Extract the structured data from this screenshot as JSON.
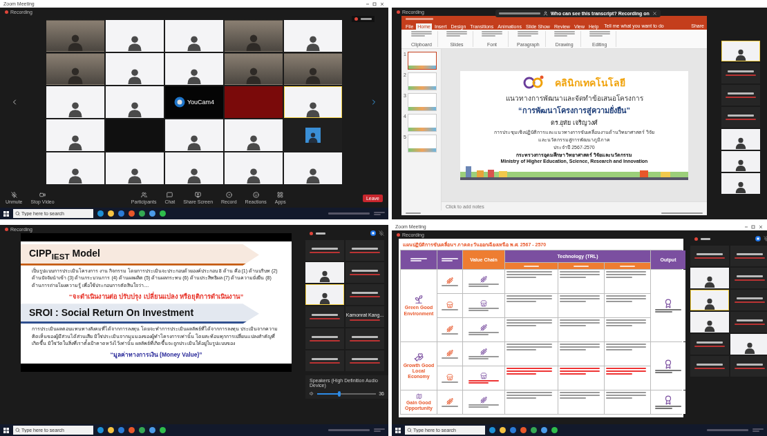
{
  "panels": [
    {
      "kind": "gallery",
      "window_title": "Zoom Meeting",
      "recording": "Recording",
      "tiles": [
        {
          "kind": "camera",
          "speaking": false
        },
        {
          "kind": "slide",
          "speaking": false
        },
        {
          "kind": "slide",
          "speaking": false
        },
        {
          "kind": "camera",
          "speaking": false
        },
        {
          "kind": "slide",
          "speaking": false
        },
        {
          "kind": "camera",
          "speaking": false
        },
        {
          "kind": "slide",
          "speaking": false
        },
        {
          "kind": "slide",
          "speaking": false
        },
        {
          "kind": "camera",
          "speaking": false
        },
        {
          "kind": "camera",
          "speaking": false
        },
        {
          "kind": "slide",
          "speaking": false
        },
        {
          "kind": "slide",
          "speaking": false
        },
        {
          "kind": "logo",
          "label": "YouCam4",
          "speaking": false
        },
        {
          "kind": "blank-red",
          "speaking": false
        },
        {
          "kind": "slide",
          "speaking": true
        },
        {
          "kind": "slide",
          "speaking": false
        },
        {
          "kind": "blank-dark",
          "speaking": false
        },
        {
          "kind": "slide",
          "speaking": false
        },
        {
          "kind": "slide",
          "speaking": false
        },
        {
          "kind": "avatar",
          "speaking": false
        },
        {
          "kind": "slide",
          "speaking": false
        },
        {
          "kind": "slide",
          "speaking": false
        },
        {
          "kind": "slide",
          "speaking": false
        },
        {
          "kind": "slide",
          "speaking": false
        },
        {
          "kind": "slide",
          "speaking": false
        }
      ],
      "toolbar_left": [
        {
          "kind": "mic",
          "label": "Unmute"
        },
        {
          "kind": "video",
          "label": "Stop Video"
        }
      ],
      "toolbar_center": [
        {
          "kind": "people",
          "label": "Participants"
        },
        {
          "kind": "chat",
          "label": "Chat"
        },
        {
          "kind": "share",
          "label": "Share Screen"
        },
        {
          "kind": "record",
          "label": "Record"
        },
        {
          "kind": "react",
          "label": "Reactions"
        },
        {
          "kind": "apps",
          "label": "Apps"
        }
      ],
      "leave": "Leave",
      "taskbar": {
        "search_placeholder": "Type here to search"
      }
    },
    {
      "kind": "presentation",
      "recording": "Recording",
      "notice": "Who can see this transcript? Recording on",
      "ribbon_tabs": [
        {
          "label": "File",
          "selected": false
        },
        {
          "label": "Home",
          "selected": true
        },
        {
          "label": "Insert",
          "selected": false
        },
        {
          "label": "Design",
          "selected": false
        },
        {
          "label": "Transitions",
          "selected": false
        },
        {
          "label": "Animations",
          "selected": false
        },
        {
          "label": "Slide Show",
          "selected": false
        },
        {
          "label": "Review",
          "selected": false
        },
        {
          "label": "View",
          "selected": false
        },
        {
          "label": "Help",
          "selected": false
        }
      ],
      "tell_me": "Tell me what you want to do",
      "share": "Share",
      "ribbon_groups": [
        "Clipboard",
        "Slides",
        "Font",
        "Paragraph",
        "Drawing",
        "Editing"
      ],
      "thumbnails": [
        {
          "number": "1",
          "selected": true
        },
        {
          "number": "2",
          "selected": false
        },
        {
          "number": "3",
          "selected": false
        },
        {
          "number": "4",
          "selected": false
        },
        {
          "number": "5",
          "selected": false
        }
      ],
      "slide": {
        "brand": "คลินิกเทคโนโลยี",
        "lines": [
          {
            "kind": "heading",
            "text": "แนวทางการพัฒนาและจัดทำข้อเสนอโครงการ"
          },
          {
            "kind": "title",
            "text": "“การพัฒนาโครงการสู่ความยั่งยืน”"
          },
          {
            "kind": "name",
            "text": "ดร.อุทัย เจริญวงศ์"
          },
          {
            "kind": "small",
            "text": "การประชุมเชิงปฏิบัติการและแนวทางการขับเคลื่อนงานด้านวิทยาศาสตร์ วิจัย"
          },
          {
            "kind": "small",
            "text": "และนวัตกรรมสู่การพัฒนาภูมิภาค"
          },
          {
            "kind": "small",
            "text": "ประจำปี 2567-2570"
          },
          {
            "kind": "ministry",
            "text": "กระทรวงการอุดมศึกษา วิทยาศาสตร์ วิจัยและนวัตกรรม"
          },
          {
            "kind": "ministry",
            "text": "Ministry of Higher Education, Science, Research and Innovation"
          }
        ]
      },
      "notes_placeholder": "Click to add notes",
      "participants": [
        {
          "kind": "video",
          "speaking": true
        },
        {
          "kind": "name",
          "speaking": false
        },
        {
          "kind": "name",
          "speaking": false
        },
        {
          "kind": "name",
          "speaking": false
        },
        {
          "kind": "video",
          "speaking": false
        },
        {
          "kind": "video",
          "speaking": false
        },
        {
          "kind": "video",
          "speaking": false
        }
      ]
    },
    {
      "kind": "slide-share",
      "recording": "Recording",
      "sections": [
        {
          "heading": "CIPP$_{IEST}$ Model",
          "color": "#c55a11",
          "body": "เป็นรูปแบบการประเมินโครงการ งาน กิจกรรม โดยการประเมินจะประกอบด้วยองค์ประกอบ 8 ด้าน คือ (1) ด้านบริบท (2) ด้านปัจจัยนำเข้า (3) ด้านกระบวนการ (4) ด้านผลผลิต (5) ด้านผลกระทบ (6) ด้านประสิทธิผล (7) ด้านความยั่งยืน (8) ด้านการถ่ายโยงความรู้ เพื่อใช้ประกอบการตัดสินใจว่า....",
          "quote": "“จะดำเนินงานต่อ ปรับปรุง เปลี่ยนแปลง หรือยุติการดำเนินงาน”"
        },
        {
          "heading": "SROI : Social Return On Investment",
          "color": "#2f4f8f",
          "body": "การประเมินผลตอบแทนทางสังคมที่ได้จากการลงทุน โดยจะทำการประเมินผลลัพธ์ที่ได้จากการลงทุน ประเมินจากความคิดเห็นของผู้มีส่วนได้ส่วนเสีย มิใช่ประเมินจากมุมมองของผู้ทำโครงการเท่านั้น โดยสะท้อนทุกการเปลี่ยนแปลงสำคัญที่เกิดขึ้น มิใช่วัดในสิ่งที่เราตั้งเป้าคาดหวังไว้เท่านั้น ผลลัพธ์ที่เกิดขึ้นจะถูกประเมินให้อยู่ในรูปแบบของ",
          "quote": "“มูลค่าทางการเงิน (Money Value)”"
        }
      ],
      "participants": [
        {
          "kind": "name",
          "speaking": false
        },
        {
          "kind": "name",
          "speaking": false
        },
        {
          "kind": "video",
          "speaking": false
        },
        {
          "kind": "name",
          "speaking": false
        },
        {
          "kind": "video",
          "speaking": true
        },
        {
          "kind": "name",
          "speaking": false
        },
        {
          "kind": "name",
          "speaking": false
        },
        {
          "kind": "name",
          "name": "Kamonrat Kang...",
          "speaking": false
        },
        {
          "kind": "name",
          "speaking": false
        },
        {
          "kind": "name",
          "speaking": false
        },
        {
          "kind": "name",
          "speaking": false
        },
        {
          "kind": "name",
          "speaking": false
        }
      ],
      "speaker": {
        "label": "Speakers (High Definition Audio Device)",
        "level": 0.38,
        "reading": "36"
      },
      "taskbar": {
        "search_placeholder": "Type here to search"
      }
    },
    {
      "kind": "table-share",
      "window_title": "Zoom Meeting",
      "recording": "Recording",
      "table": {
        "title": "แผนปฏิบัติการขับเคลื่อนฯ ภาคตะวันออกเฉียงเหนือ พ.ศ. 2567 - 2570",
        "headers": [
          {
            "kind": "blur",
            "color": "#7b4fa0"
          },
          {
            "kind": "blur",
            "color": "#7b4fa0"
          },
          {
            "kind": "text",
            "text": "Value Chain",
            "color": "#ee7d31"
          },
          {
            "kind": "text",
            "text": "Technology (TRL)",
            "color": "#7b4fa0"
          },
          {
            "kind": "text",
            "text": "Output",
            "color": "#7b4fa0"
          }
        ],
        "subheaders": [
          {
            "kind": "blur",
            "color": "#ee7d31"
          },
          {
            "kind": "blur",
            "color": "#ee7d31"
          },
          {
            "kind": "blur",
            "color": "#ee7d31"
          }
        ],
        "groups": [
          {
            "label": "Green Good Environment",
            "rows": [
              {
                "kind": "plain"
              },
              {
                "kind": "plain"
              },
              {
                "kind": "plain"
              }
            ]
          },
          {
            "label": "Growth Good Local Economy",
            "rows": [
              {
                "kind": "plain"
              },
              {
                "kind": "highlight"
              }
            ]
          },
          {
            "label": "Gain Good Opportunity",
            "rows": [
              {
                "kind": "plain"
              }
            ]
          }
        ]
      },
      "participants": [
        {
          "kind": "name",
          "speaking": false
        },
        {
          "kind": "name",
          "speaking": false
        },
        {
          "kind": "video",
          "speaking": false
        },
        {
          "kind": "name",
          "speaking": false
        },
        {
          "kind": "video",
          "speaking": true
        },
        {
          "kind": "name",
          "speaking": false
        },
        {
          "kind": "video",
          "speaking": false
        },
        {
          "kind": "name",
          "speaking": false
        },
        {
          "kind": "name",
          "speaking": false
        },
        {
          "kind": "video",
          "speaking": false
        },
        {
          "kind": "name",
          "speaking": false
        },
        {
          "kind": "name",
          "speaking": false
        }
      ],
      "taskbar": {
        "search_placeholder": "Type here to search"
      }
    }
  ]
}
